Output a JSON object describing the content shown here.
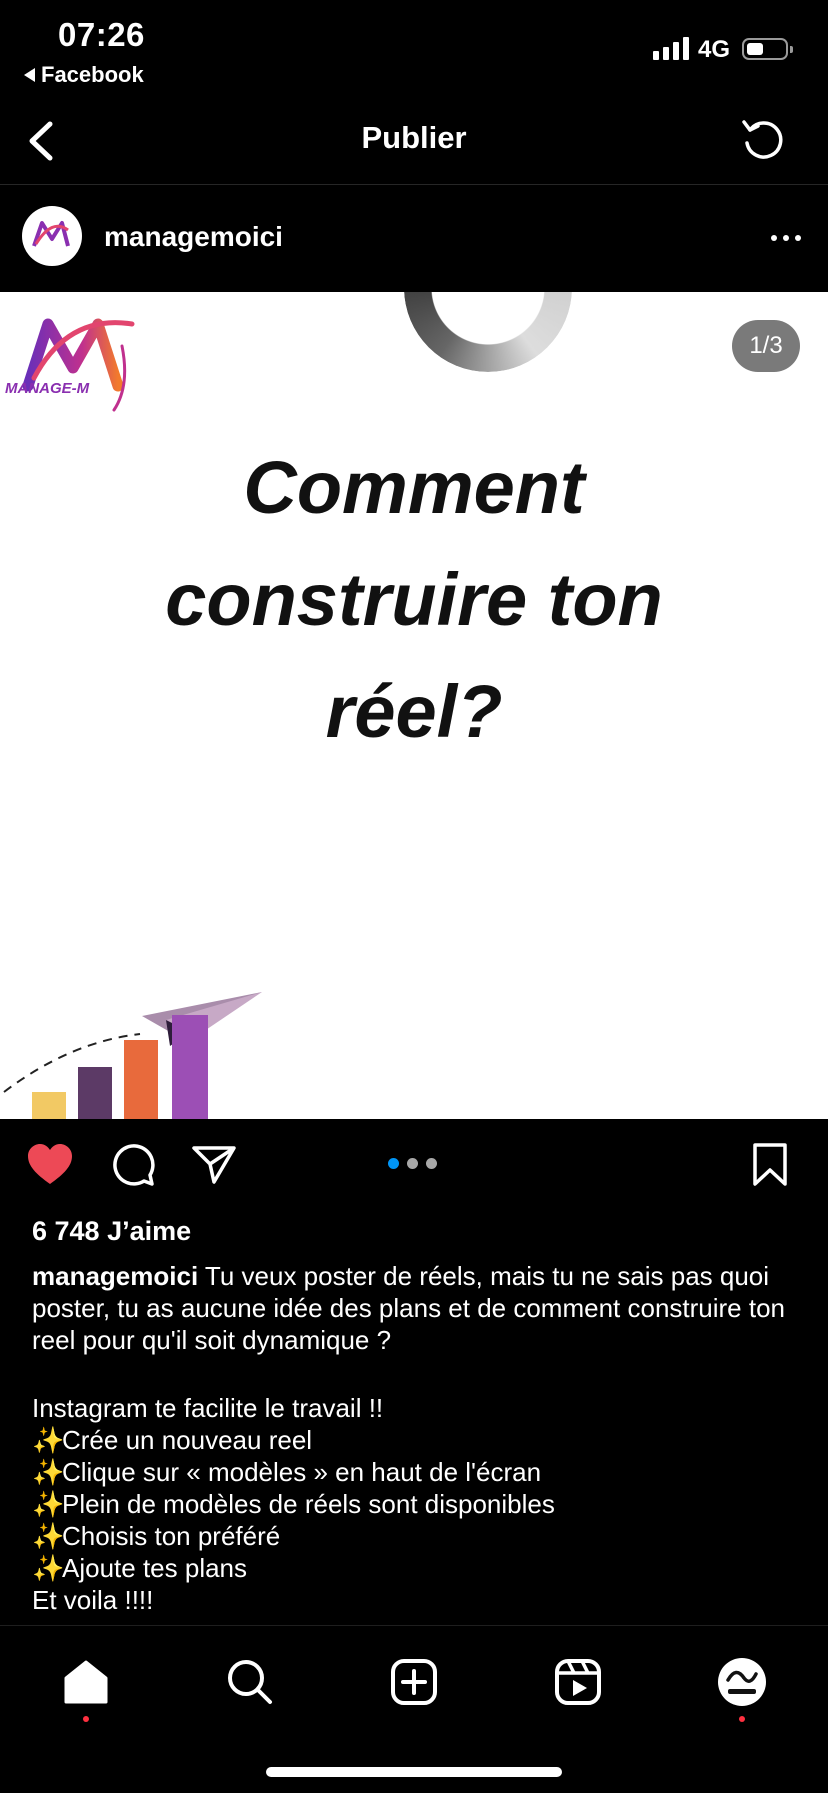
{
  "status_bar": {
    "time": "07:26",
    "back_app": "Facebook",
    "network": "4G",
    "battery_percent": 35
  },
  "header": {
    "title": "Publier"
  },
  "post": {
    "username": "managemoici",
    "image": {
      "brand_text": "MANAGE-M",
      "counter": "1/3",
      "headline_lines": [
        "Comment",
        "construire ton",
        "réel?"
      ]
    },
    "carousel": {
      "total": 3,
      "active_index": 0
    },
    "likes": "6 748 J’aime",
    "caption": {
      "username": "managemoici",
      "text": " Tu veux poster de réels, mais tu ne sais pas quoi poster, tu as aucune idée des plans et de comment construire ton reel pour qu'il soit dynamique ?",
      "intro": "Instagram te facilite le travail !!",
      "steps": [
        "Crée un nouveau reel",
        "Clique sur « modèles » en haut de l'écran",
        "Plein de modèles de réels sont disponibles",
        "Choisis ton préféré",
        "Ajoute tes plans"
      ],
      "truncated_line": "Et voila !!!!"
    }
  },
  "colors": {
    "like": "#ed4956",
    "active_dot": "#0095f6",
    "inactive_dot": "#a8a8a8",
    "notification_dot": "#ff3040"
  },
  "tab_bar": [
    "home-icon",
    "search-icon",
    "create-icon",
    "reels-icon",
    "profile-icon"
  ]
}
